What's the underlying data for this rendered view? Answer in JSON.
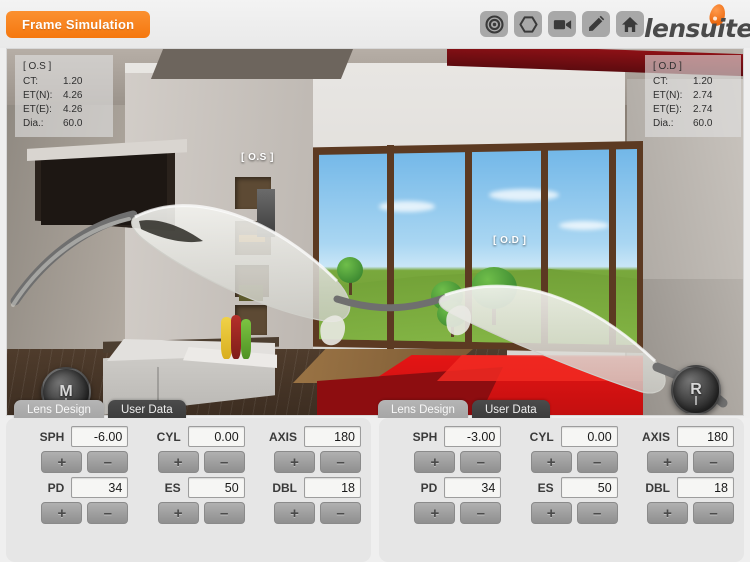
{
  "header": {
    "frame_sim_label": "Frame Simulation",
    "brand": "lensuite",
    "accent_color": "#f5780f",
    "tools": [
      {
        "name": "target-icon",
        "label": "Target"
      },
      {
        "name": "hexagon-icon",
        "label": "Shape"
      },
      {
        "name": "video-camera-icon",
        "label": "Camera"
      },
      {
        "name": "pencil-icon",
        "label": "Edit"
      },
      {
        "name": "home-icon",
        "label": "Home"
      }
    ]
  },
  "viewport": {
    "hud_left": {
      "title": "[ O.S ]",
      "rows": [
        {
          "key": "CT:",
          "value": "1.20"
        },
        {
          "key": "ET(N):",
          "value": "4.26"
        },
        {
          "key": "ET(E):",
          "value": "4.26"
        },
        {
          "key": "Dia.:",
          "value": "60.0"
        }
      ]
    },
    "hud_right": {
      "title": "[ O.D ]",
      "rows": [
        {
          "key": "CT:",
          "value": "1.20"
        },
        {
          "key": "ET(N):",
          "value": "2.74"
        },
        {
          "key": "ET(E):",
          "value": "2.74"
        },
        {
          "key": "Dia.:",
          "value": "60.0"
        }
      ]
    },
    "label_os": "[ O.S ]",
    "label_od": "[ O.D ]",
    "knob_left": "M",
    "knob_right": "R"
  },
  "tabs_left": [
    {
      "label": "Lens Design",
      "active": true
    },
    {
      "label": "User Data",
      "active": false
    }
  ],
  "tabs_right": [
    {
      "label": "Lens Design",
      "active": true
    },
    {
      "label": "User Data",
      "active": false
    }
  ],
  "plus_label": "+",
  "minus_label": "–",
  "panel_left": {
    "row1": [
      {
        "label": "SPH",
        "value": "-6.00"
      },
      {
        "label": "CYL",
        "value": "0.00"
      },
      {
        "label": "AXIS",
        "value": "180"
      }
    ],
    "row2": [
      {
        "label": "PD",
        "value": "34"
      },
      {
        "label": "ES",
        "value": "50"
      },
      {
        "label": "DBL",
        "value": "18"
      }
    ]
  },
  "panel_right": {
    "row1": [
      {
        "label": "SPH",
        "value": "-3.00"
      },
      {
        "label": "CYL",
        "value": "0.00"
      },
      {
        "label": "AXIS",
        "value": "180"
      }
    ],
    "row2": [
      {
        "label": "PD",
        "value": "34"
      },
      {
        "label": "ES",
        "value": "50"
      },
      {
        "label": "DBL",
        "value": "18"
      }
    ]
  }
}
